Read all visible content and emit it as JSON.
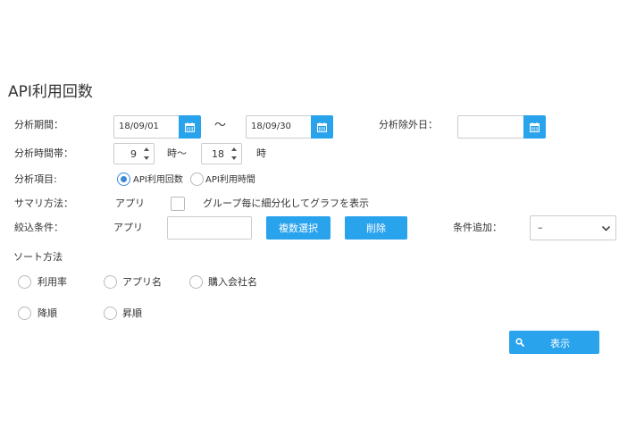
{
  "page": {
    "title": "API利用回数"
  },
  "analysis_period": {
    "label": "分析期間：",
    "from": "18/09/01",
    "separator": "〜",
    "to": "18/09/30",
    "calendar_icon": "calendar-icon"
  },
  "excluded_days": {
    "label": "分析除外日：",
    "value": "",
    "calendar_icon": "calendar-icon"
  },
  "time_band": {
    "label": "分析時間帯：",
    "from_hour": "9",
    "from_suffix": "時〜",
    "to_hour": "18",
    "to_suffix": "時"
  },
  "analysis_item": {
    "label": "分析項目:",
    "options": [
      {
        "label": "API利用回数",
        "selected": true
      },
      {
        "label": "API利用時間",
        "selected": false
      }
    ]
  },
  "summary_method": {
    "label": "サマリ方法：",
    "value": "アプリ",
    "checkbox_label": "グループ毎に細分化してグラフを表示",
    "checked": false
  },
  "filter": {
    "label": "絞込条件：",
    "type_label": "アプリ",
    "input_value": "",
    "multi_select_button": "複数選択",
    "delete_button": "削除",
    "add_condition_label": "条件追加：",
    "add_condition_value": "–"
  },
  "sort": {
    "label": "ソート方法",
    "keys": [
      {
        "label": "利用率",
        "selected": false
      },
      {
        "label": "アプリ名",
        "selected": false
      },
      {
        "label": "購入会社名",
        "selected": false
      }
    ],
    "orders": [
      {
        "label": "降順",
        "selected": false
      },
      {
        "label": "昇順",
        "selected": false
      }
    ]
  },
  "show_button": {
    "label": "表示",
    "icon": "search-icon"
  },
  "colors": {
    "accent": "#2aa3ed",
    "radio_selected": "#3a8ad8",
    "border": "#cccccc"
  }
}
